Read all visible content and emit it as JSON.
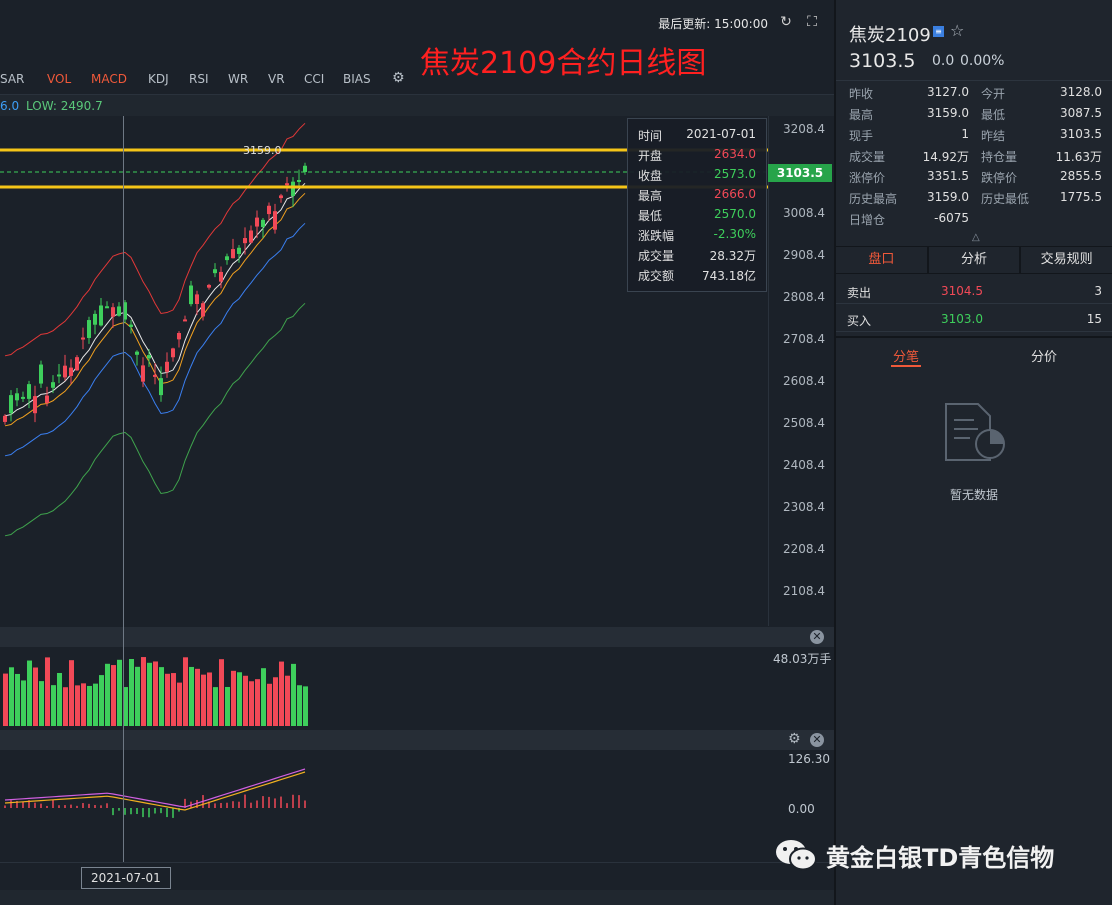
{
  "header": {
    "last_update": "最后更新: 15:00:00",
    "overlay_title": "焦炭2109合约日线图"
  },
  "indicators": {
    "tabs": [
      "SAR",
      "VOL",
      "MACD",
      "KDJ",
      "RSI",
      "WR",
      "VR",
      "CCI",
      "BIAS"
    ],
    "active": [
      "VOL",
      "MACD"
    ]
  },
  "info_strip": {
    "high": "6.0",
    "low": "LOW: 2490.7"
  },
  "price_axis": {
    "ticks": [
      "3208.4",
      "3108.4",
      "3008.4",
      "2908.4",
      "2808.4",
      "2708.4",
      "2608.4",
      "2508.4",
      "2408.4",
      "2308.4",
      "2208.4",
      "2108.4"
    ],
    "current_price_tag": "3103.5",
    "max_label": "3159.0"
  },
  "tooltip": {
    "rows": [
      {
        "k": "时间",
        "v": "2021-07-01",
        "tone": "neutral"
      },
      {
        "k": "开盘",
        "v": "2634.0",
        "tone": "red"
      },
      {
        "k": "收盘",
        "v": "2573.0",
        "tone": "green"
      },
      {
        "k": "最高",
        "v": "2666.0",
        "tone": "red"
      },
      {
        "k": "最低",
        "v": "2570.0",
        "tone": "green"
      },
      {
        "k": "涨跌幅",
        "v": "-2.30%",
        "tone": "green"
      },
      {
        "k": "成交量",
        "v": "28.32万",
        "tone": "neutral"
      },
      {
        "k": "成交额",
        "v": "743.18亿",
        "tone": "neutral"
      }
    ]
  },
  "volume": {
    "axis_label": "48.03万手"
  },
  "macd": {
    "ticks": [
      "126.30",
      "0.00"
    ]
  },
  "date_axis": {
    "crosshair_date": "2021-07-01"
  },
  "quote": {
    "symbol": "焦炭2109",
    "price": "3103.5",
    "change": "0.0",
    "change_pct": "0.00%",
    "stats": [
      [
        "昨收",
        "3127.0",
        "今开",
        "3128.0"
      ],
      [
        "最高",
        "3159.0",
        "最低",
        "3087.5"
      ],
      [
        "现手",
        "1",
        "昨结",
        "3103.5"
      ],
      [
        "成交量",
        "14.92万",
        "持仓量",
        "11.63万"
      ],
      [
        "涨停价",
        "3351.5",
        "跌停价",
        "2855.5"
      ],
      [
        "历史最高",
        "3159.0",
        "历史最低",
        "1775.5"
      ],
      [
        "日增仓",
        "-6075",
        "",
        ""
      ]
    ]
  },
  "tabs_main": [
    "盘口",
    "分析",
    "交易规则"
  ],
  "order_book": {
    "sell_label": "卖出",
    "sell_price": "3104.5",
    "sell_qty": "3",
    "buy_label": "买入",
    "buy_price": "3103.0",
    "buy_qty": "15"
  },
  "tabs_trades": [
    "分笔",
    "分价"
  ],
  "empty_text": "暂无数据",
  "watermark": "黄金白银TD青色信物",
  "colors": {
    "up": "#f24957",
    "down": "#3ecf5c",
    "accent": "#f0593a",
    "resistance": "#f5c518"
  }
}
